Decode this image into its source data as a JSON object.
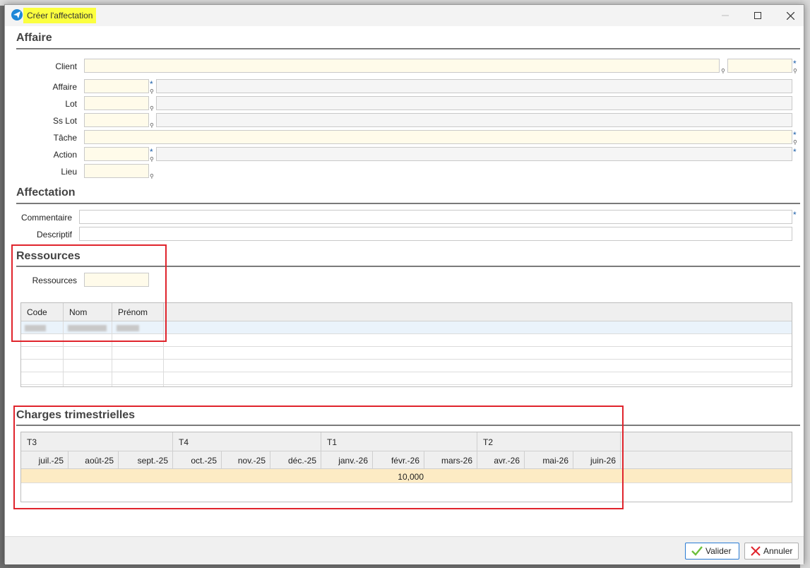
{
  "window": {
    "title": "Créer l'affectation"
  },
  "affaire": {
    "section_title": "Affaire",
    "client_label": "Client",
    "affaire_label": "Affaire",
    "lot_label": "Lot",
    "sslot_label": "Ss Lot",
    "tache_label": "Tâche",
    "action_label": "Action",
    "lieu_label": "Lieu",
    "required_mark": "*"
  },
  "affectation": {
    "section_title": "Affectation",
    "commentaire_label": "Commentaire",
    "descriptif_label": "Descriptif"
  },
  "ressources": {
    "section_title": "Ressources",
    "ressources_label": "Ressources",
    "columns": [
      "Code",
      "Nom",
      "Prénom"
    ]
  },
  "charges": {
    "section_title": "Charges trimestrielles",
    "quarters": [
      "T3",
      "T4",
      "T1",
      "T2"
    ],
    "months": [
      "juil.-25",
      "août-25",
      "sept.-25",
      "oct.-25",
      "nov.-25",
      "déc.-25",
      "janv.-26",
      "févr.-26",
      "mars-26",
      "avr.-26",
      "mai-26",
      "juin-26"
    ],
    "total_value": "10,000"
  },
  "footer": {
    "validate_label": "Valider",
    "cancel_label": "Annuler"
  },
  "colors": {
    "title_highlight": "#fbff3f",
    "annotation_red": "#e0242c",
    "required_star": "#1b5ea8",
    "mandatory_field_bg": "#fffbea",
    "selected_row": "#eaf3fb",
    "charges_row": "#fdebc4"
  },
  "icons": {
    "app": "paper-plane-icon",
    "lookup": "pin-icon",
    "validate": "check-icon",
    "cancel": "x-icon"
  }
}
